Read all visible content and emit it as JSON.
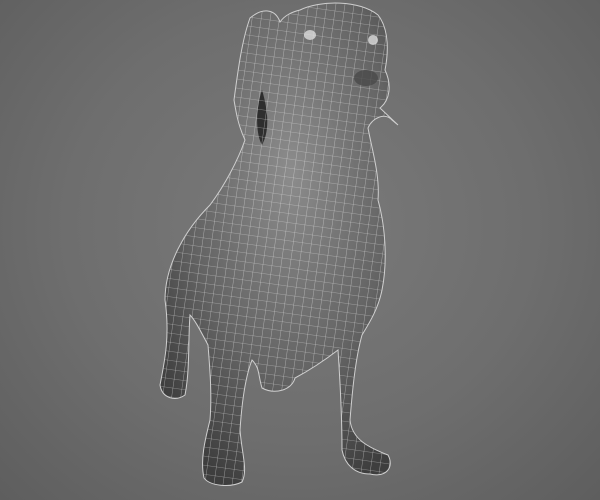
{
  "scene": {
    "subject": "dog-wireframe-model",
    "colors": {
      "background": "#6e6e6e",
      "model_light": "#8a8a8a",
      "model_dark": "#3a3a3a",
      "wire": "#e8e8e8"
    }
  }
}
